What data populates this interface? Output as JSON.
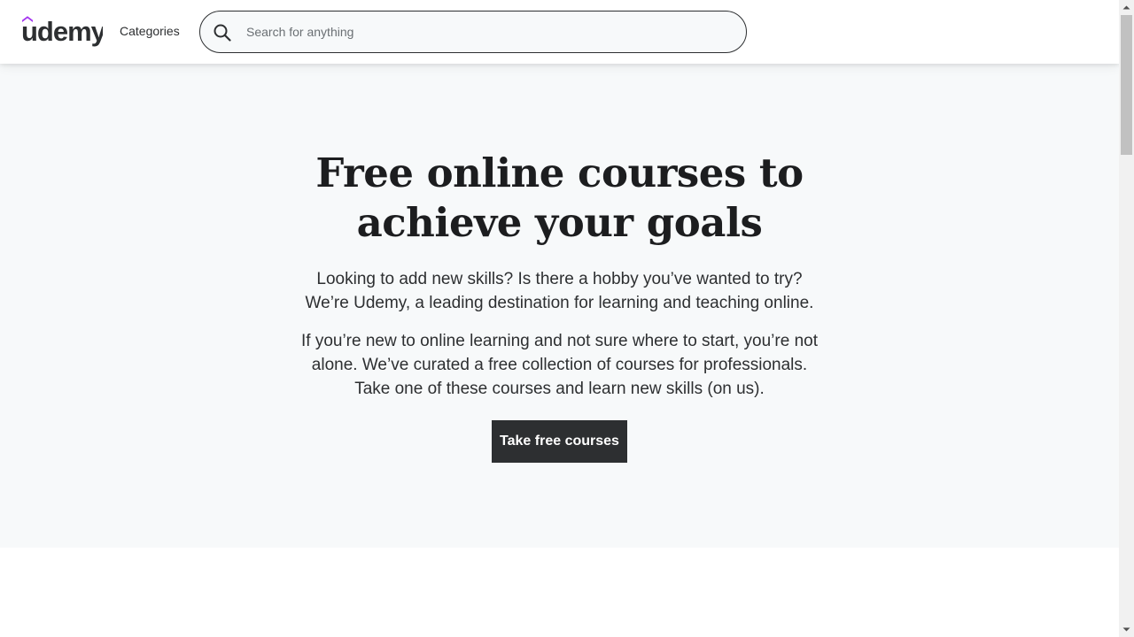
{
  "header": {
    "logo_text": "udemy",
    "categories_label": "Categories",
    "search": {
      "placeholder": "Search for anything",
      "value": ""
    }
  },
  "hero": {
    "title_line1": "Free online courses to",
    "title_line2": "achieve your goals",
    "paragraph1": "Looking to add new skills? Is there a hobby you’ve wanted to try? We’re Udemy, a leading destination for learning and teaching online.",
    "paragraph2": "If you’re new to online learning and not sure where to start, you’re not alone. We’ve curated a free collection of courses for professionals. Take one of these courses and learn new skills (on us).",
    "cta_label": "Take free courses"
  },
  "icons": {
    "search": "search-icon",
    "scroll_up": "chevron-up-icon",
    "scroll_down": "chevron-down-icon"
  },
  "colors": {
    "brand_purple": "#a435f0",
    "text_dark": "#2d2f31",
    "hero_bg": "#f7f9fa",
    "cta_bg": "#2d2f31"
  }
}
